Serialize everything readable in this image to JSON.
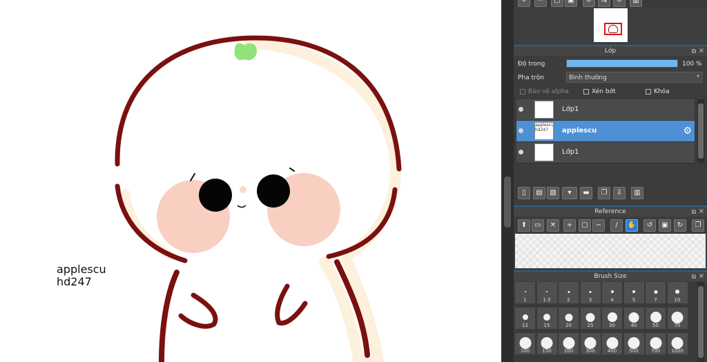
{
  "canvas": {
    "watermark_line1": "applescu",
    "watermark_line2": "hd247",
    "colors": {
      "outline": "#7a1010",
      "cheek": "#f9cfc2",
      "shadow": "#fdf0dc",
      "leaf": "#8fe37a",
      "eye": "#050505"
    }
  },
  "navigator": {
    "toolbar_icons": [
      "zoom-in-icon",
      "zoom-out-icon",
      "fit-icon",
      "actual-size-icon",
      "rotate-left-icon",
      "flip-icon",
      "rotate-right-icon",
      "reset-icon"
    ]
  },
  "layer_panel": {
    "title": "Lớp",
    "opacity_label": "Độ trong",
    "opacity_value": "100 %",
    "opacity_fraction": 1.0,
    "blend_label": "Pha trộn",
    "blend_value": "Bình thường",
    "protect_alpha_label": "Bảo vệ alpha",
    "clipping_label": "Xén bớt",
    "lock_label": "Khóa",
    "layers": [
      {
        "name": "Lớp1",
        "thumb_text": "",
        "selected": false
      },
      {
        "name": "applescu",
        "thumb_text": "applescu hd247",
        "selected": true
      },
      {
        "name": "Lớp1",
        "thumb_text": "",
        "selected": false
      }
    ]
  },
  "reference_panel": {
    "title": "Reference"
  },
  "brush_size_panel": {
    "title": "Brush Size",
    "sizes": [
      "1",
      "1.5",
      "2",
      "3",
      "4",
      "5",
      "7",
      "10",
      "12",
      "15",
      "20",
      "25",
      "30",
      "40",
      "50",
      "70",
      "100",
      "150",
      "200",
      "300",
      "400",
      "500",
      "700",
      "1000"
    ]
  }
}
